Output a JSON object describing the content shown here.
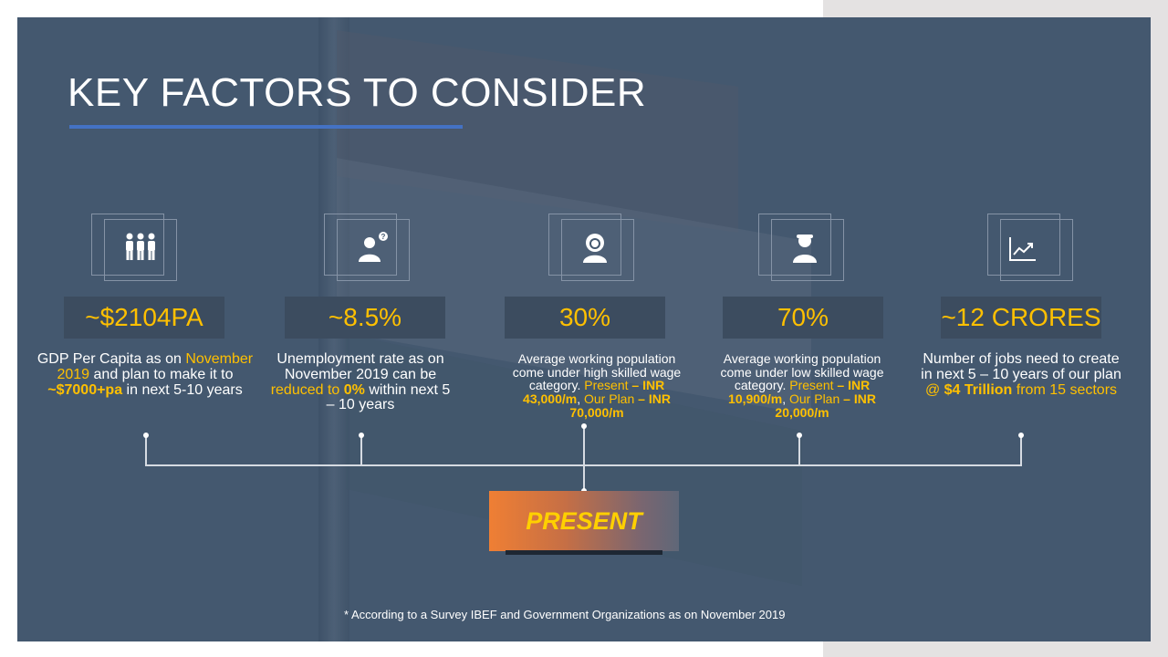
{
  "slide": {
    "title": "KEY FACTORS TO CONSIDER",
    "footnote": "* According to a Survey  IBEF and Government  Organizations as on November  2019",
    "present_label": "PRESENT",
    "colors": {
      "accent": "#ffc000",
      "background": "#44586f",
      "underline": "#4472c4"
    }
  },
  "factors": [
    {
      "icon": "group-people-icon",
      "stat": "~$2104PA",
      "desc": {
        "p1": "GDP Per Capita as on ",
        "h1": "November 2019",
        "p2": " and plan to make it to ",
        "h2": "~$7000+pa",
        "p3": " in next 5-10 years"
      }
    },
    {
      "icon": "person-question-icon",
      "stat": "~8.5%",
      "desc": {
        "p1": "Unemployment rate as on November 2019 can be ",
        "h1": "reduced to ",
        "h2": "0%",
        "p2": " within next 5 – 10 years"
      }
    },
    {
      "icon": "skilled-worker-icon",
      "stat": "30%",
      "desc": {
        "p1": "Average working population come under high skilled wage category. ",
        "h1": "Present",
        "h2": " – INR 43,000/m",
        "p2": ", ",
        "h3": "Our Plan",
        "h4": " – INR 70,000/m"
      }
    },
    {
      "icon": "worker-icon",
      "stat": "70%",
      "desc": {
        "p1": "Average working population come under low skilled wage category. ",
        "h1": "Present",
        "h2": " – INR 10,900/m",
        "p2": ", ",
        "h3": "Our Plan",
        "h4": " – INR 20,000/m"
      }
    },
    {
      "icon": "growth-chart-icon",
      "stat": "~12 CRORES",
      "desc": {
        "p1": "Number of jobs need to create in next 5 – 10 years of our plan ",
        "h1": "@ ",
        "h2": "$4 Trillion",
        "h3": " from 15 sectors"
      }
    }
  ]
}
